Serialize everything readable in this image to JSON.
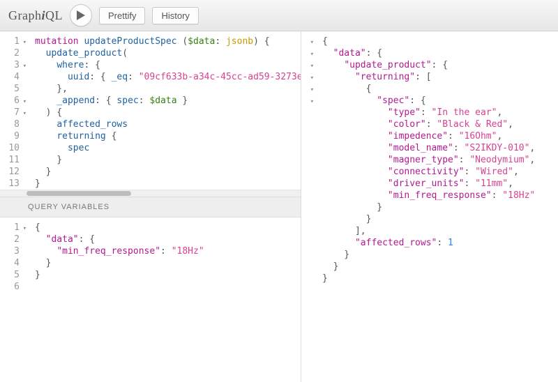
{
  "toolbar": {
    "logo_prefix": "Graph",
    "logo_em": "i",
    "logo_suffix": "QL",
    "prettify": "Prettify",
    "history": "History"
  },
  "sections": {
    "query_variables": "Query Variables"
  },
  "query_lines": [
    {
      "n": 1,
      "fold": "v",
      "segs": [
        [
          "kw",
          "mutation"
        ],
        [
          "punct",
          " "
        ],
        [
          "def",
          "updateProductSpec"
        ],
        [
          "punct",
          " ("
        ],
        [
          "var",
          "$data"
        ],
        [
          "punct",
          ": "
        ],
        [
          "type",
          "jsonb"
        ],
        [
          "punct",
          ") {"
        ]
      ]
    },
    {
      "n": 2,
      "fold": "",
      "segs": [
        [
          "punct",
          "  "
        ],
        [
          "attr",
          "update_product"
        ],
        [
          "punct",
          "("
        ]
      ]
    },
    {
      "n": 3,
      "fold": "v",
      "segs": [
        [
          "punct",
          "    "
        ],
        [
          "attr",
          "where"
        ],
        [
          "punct",
          ": {"
        ]
      ]
    },
    {
      "n": 4,
      "fold": "",
      "segs": [
        [
          "punct",
          "      "
        ],
        [
          "attr",
          "uuid"
        ],
        [
          "punct",
          ": {"
        ],
        [
          "attr",
          " _eq"
        ],
        [
          "punct",
          ": "
        ],
        [
          "str",
          "\"09cf633b-a34c-45cc-ad59-3273e"
        ]
      ]
    },
    {
      "n": 5,
      "fold": "",
      "segs": [
        [
          "punct",
          "    },"
        ]
      ]
    },
    {
      "n": 6,
      "fold": "v",
      "segs": [
        [
          "punct",
          "    "
        ],
        [
          "attr",
          "_append"
        ],
        [
          "punct",
          ": { "
        ],
        [
          "attr",
          "spec"
        ],
        [
          "punct",
          ": "
        ],
        [
          "var",
          "$data"
        ],
        [
          "punct",
          " }"
        ]
      ]
    },
    {
      "n": 7,
      "fold": "v",
      "segs": [
        [
          "punct",
          "  ) {"
        ]
      ]
    },
    {
      "n": 8,
      "fold": "",
      "segs": [
        [
          "punct",
          "    "
        ],
        [
          "attr",
          "affected_rows"
        ]
      ]
    },
    {
      "n": 9,
      "fold": "",
      "segs": [
        [
          "punct",
          "    "
        ],
        [
          "attr",
          "returning"
        ],
        [
          "punct",
          " {"
        ]
      ]
    },
    {
      "n": 10,
      "fold": "",
      "segs": [
        [
          "punct",
          "      "
        ],
        [
          "attr",
          "spec"
        ]
      ]
    },
    {
      "n": 11,
      "fold": "",
      "segs": [
        [
          "punct",
          "    }"
        ]
      ]
    },
    {
      "n": 12,
      "fold": "",
      "segs": [
        [
          "punct",
          "  }"
        ]
      ]
    },
    {
      "n": 13,
      "fold": "",
      "segs": [
        [
          "punct",
          "}"
        ]
      ]
    }
  ],
  "vars_lines": [
    {
      "n": 1,
      "fold": "v",
      "segs": [
        [
          "brace",
          "{"
        ]
      ]
    },
    {
      "n": 2,
      "fold": "",
      "segs": [
        [
          "punct",
          "  "
        ],
        [
          "prop",
          "\"data\""
        ],
        [
          "punct",
          ": "
        ],
        [
          "brace",
          "{"
        ]
      ]
    },
    {
      "n": 3,
      "fold": "",
      "segs": [
        [
          "punct",
          "    "
        ],
        [
          "prop",
          "\"min_freq_response\""
        ],
        [
          "punct",
          ": "
        ],
        [
          "str",
          "\"18Hz\""
        ]
      ]
    },
    {
      "n": 4,
      "fold": "",
      "segs": [
        [
          "punct",
          "  "
        ],
        [
          "brace",
          "}"
        ]
      ]
    },
    {
      "n": 5,
      "fold": "",
      "segs": [
        [
          "brace",
          "}"
        ]
      ]
    },
    {
      "n": 6,
      "fold": "",
      "segs": [
        [
          "punct",
          ""
        ]
      ]
    }
  ],
  "result_lines": [
    {
      "fold": "v",
      "segs": [
        [
          "brace",
          "{"
        ]
      ]
    },
    {
      "fold": "v",
      "segs": [
        [
          "punct",
          "  "
        ],
        [
          "prop",
          "\"data\""
        ],
        [
          "punct",
          ": {"
        ]
      ]
    },
    {
      "fold": "v",
      "segs": [
        [
          "punct",
          "    "
        ],
        [
          "prop",
          "\"update_product\""
        ],
        [
          "punct",
          ": {"
        ]
      ]
    },
    {
      "fold": "v",
      "segs": [
        [
          "punct",
          "      "
        ],
        [
          "prop",
          "\"returning\""
        ],
        [
          "punct",
          ": ["
        ]
      ]
    },
    {
      "fold": "v",
      "segs": [
        [
          "punct",
          "        {"
        ]
      ]
    },
    {
      "fold": "v",
      "segs": [
        [
          "punct",
          "          "
        ],
        [
          "prop",
          "\"spec\""
        ],
        [
          "punct",
          ": {"
        ]
      ]
    },
    {
      "fold": "",
      "segs": [
        [
          "punct",
          "            "
        ],
        [
          "prop",
          "\"type\""
        ],
        [
          "punct",
          ": "
        ],
        [
          "str",
          "\"In the ear\""
        ],
        [
          "punct",
          ","
        ]
      ]
    },
    {
      "fold": "",
      "segs": [
        [
          "punct",
          "            "
        ],
        [
          "prop",
          "\"color\""
        ],
        [
          "punct",
          ": "
        ],
        [
          "str",
          "\"Black & Red\""
        ],
        [
          "punct",
          ","
        ]
      ]
    },
    {
      "fold": "",
      "segs": [
        [
          "punct",
          "            "
        ],
        [
          "prop",
          "\"impedence\""
        ],
        [
          "punct",
          ": "
        ],
        [
          "str",
          "\"16Ohm\""
        ],
        [
          "punct",
          ","
        ]
      ]
    },
    {
      "fold": "",
      "segs": [
        [
          "punct",
          "            "
        ],
        [
          "prop",
          "\"model_name\""
        ],
        [
          "punct",
          ": "
        ],
        [
          "str",
          "\"S2IKDY-010\""
        ],
        [
          "punct",
          ","
        ]
      ]
    },
    {
      "fold": "",
      "segs": [
        [
          "punct",
          "            "
        ],
        [
          "prop",
          "\"magner_type\""
        ],
        [
          "punct",
          ": "
        ],
        [
          "str",
          "\"Neodymium\""
        ],
        [
          "punct",
          ","
        ]
      ]
    },
    {
      "fold": "",
      "segs": [
        [
          "punct",
          "            "
        ],
        [
          "prop",
          "\"connectivity\""
        ],
        [
          "punct",
          ": "
        ],
        [
          "str",
          "\"Wired\""
        ],
        [
          "punct",
          ","
        ]
      ]
    },
    {
      "fold": "",
      "segs": [
        [
          "punct",
          "            "
        ],
        [
          "prop",
          "\"driver_units\""
        ],
        [
          "punct",
          ": "
        ],
        [
          "str",
          "\"11mm\""
        ],
        [
          "punct",
          ","
        ]
      ]
    },
    {
      "fold": "",
      "segs": [
        [
          "punct",
          "            "
        ],
        [
          "prop",
          "\"min_freq_response\""
        ],
        [
          "punct",
          ": "
        ],
        [
          "str",
          "\"18Hz\""
        ]
      ]
    },
    {
      "fold": "",
      "segs": [
        [
          "punct",
          "          }"
        ]
      ]
    },
    {
      "fold": "",
      "segs": [
        [
          "punct",
          "        }"
        ]
      ]
    },
    {
      "fold": "",
      "segs": [
        [
          "punct",
          "      ],"
        ]
      ]
    },
    {
      "fold": "",
      "segs": [
        [
          "punct",
          "      "
        ],
        [
          "prop",
          "\"affected_rows\""
        ],
        [
          "punct",
          ": "
        ],
        [
          "num",
          "1"
        ]
      ]
    },
    {
      "fold": "",
      "segs": [
        [
          "punct",
          "    }"
        ]
      ]
    },
    {
      "fold": "",
      "segs": [
        [
          "punct",
          "  }"
        ]
      ]
    },
    {
      "fold": "",
      "segs": [
        [
          "punct",
          "}"
        ]
      ]
    }
  ]
}
